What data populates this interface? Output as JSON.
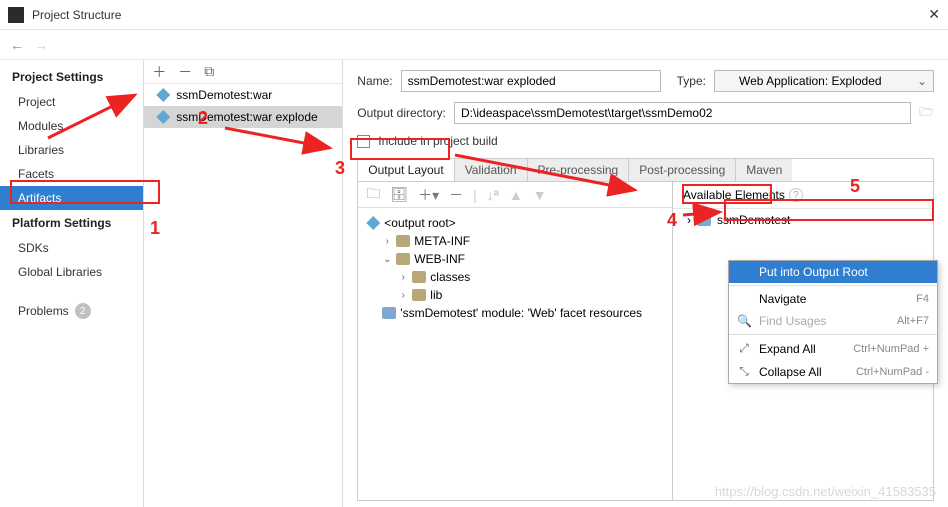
{
  "window": {
    "title": "Project Structure"
  },
  "sidebar": {
    "heading1": "Project Settings",
    "heading2": "Platform Settings",
    "items": [
      "Project",
      "Modules",
      "Libraries",
      "Facets",
      "Artifacts"
    ],
    "platform_items": [
      "SDKs",
      "Global Libraries"
    ],
    "problems_label": "Problems",
    "problems_count": "2"
  },
  "artifact_list": [
    {
      "label": "ssmDemotest:war"
    },
    {
      "label": "ssmDemotest:war explode"
    }
  ],
  "detail": {
    "name_label": "Name:",
    "name_value": "ssmDemotest:war exploded",
    "type_label": "Type:",
    "type_value": "Web Application: Exploded",
    "outdir_label": "Output directory:",
    "outdir_value": "D:\\ideaspace\\ssmDemotest\\target\\ssmDemo02",
    "include_label": "Include in project build"
  },
  "tabs": [
    "Output Layout",
    "Validation",
    "Pre-processing",
    "Post-processing",
    "Maven"
  ],
  "tree": {
    "root": "<output root>",
    "n1": "META-INF",
    "n2": "WEB-INF",
    "n3": "classes",
    "n4": "lib",
    "n5": "'ssmDemotest' module: 'Web' facet resources"
  },
  "available": {
    "title": "Available Elements",
    "proj": "ssmDemotest"
  },
  "ctx": {
    "put": "Put into Output Root",
    "nav": "Navigate",
    "nav_k": "F4",
    "find": "Find Usages",
    "find_k": "Alt+F7",
    "exp": "Expand All",
    "exp_k": "Ctrl+NumPad +",
    "col": "Collapse All",
    "col_k": "Ctrl+NumPad -"
  },
  "anno": {
    "a1": "1",
    "a2": "2",
    "a3": "3",
    "a4": "4",
    "a5": "5"
  },
  "watermark": "https://blog.csdn.net/weixin_41583535"
}
